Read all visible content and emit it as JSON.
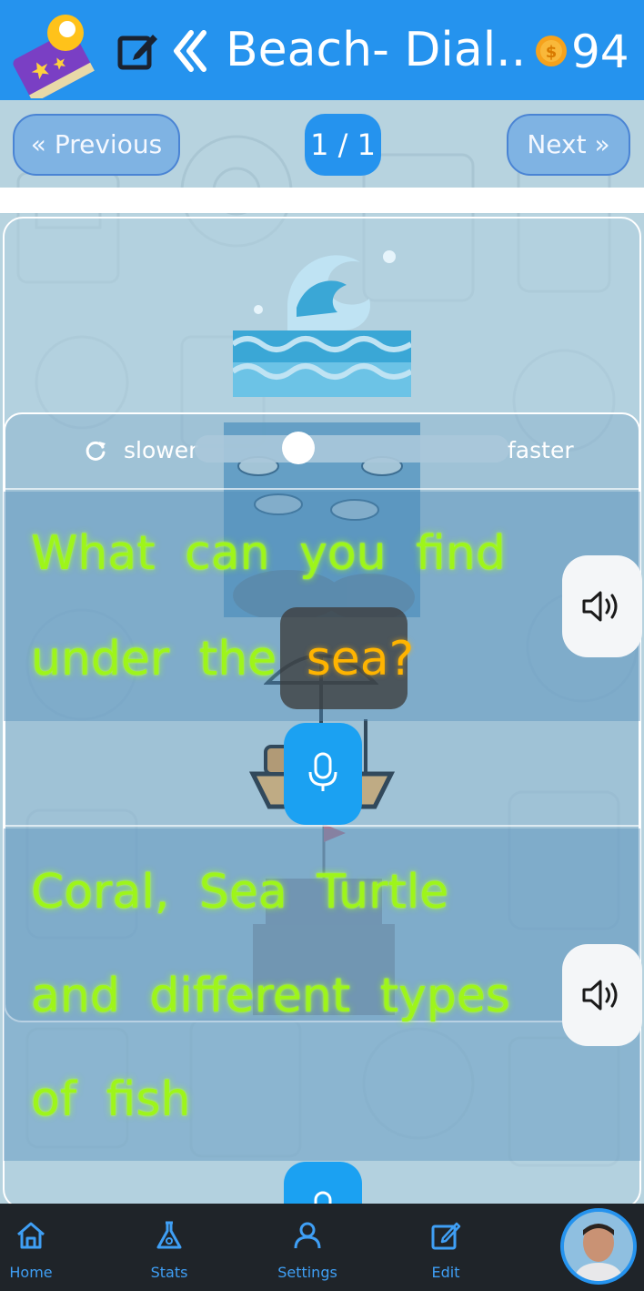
{
  "header": {
    "title": "Beach- Dial...",
    "coins": "94",
    "icons": [
      "book-icon",
      "edit-icon",
      "chevron-left-double-icon",
      "coin-icon"
    ]
  },
  "pager": {
    "previous_label": "Previous",
    "next_label": "Next",
    "page_indicator": "1 / 1"
  },
  "speed": {
    "slower_label": "slower",
    "faster_label": "faster",
    "level": 0.33
  },
  "question": {
    "line1": "What can you find",
    "line2_before": "under the ",
    "highlight": "sea?"
  },
  "answer": {
    "line1": "Coral, Sea Turtle",
    "line2": "and different types",
    "line3": "of fish"
  },
  "nav": {
    "home": "Home",
    "stats": "Stats",
    "settings": "Settings",
    "edit": "Edit"
  },
  "colors": {
    "header_blue": "#2593ee",
    "glow_green": "#9ef51a",
    "highlight_orange": "#ffb400",
    "mic_blue": "#1ba1f2",
    "nav_dark": "#1f2429"
  }
}
